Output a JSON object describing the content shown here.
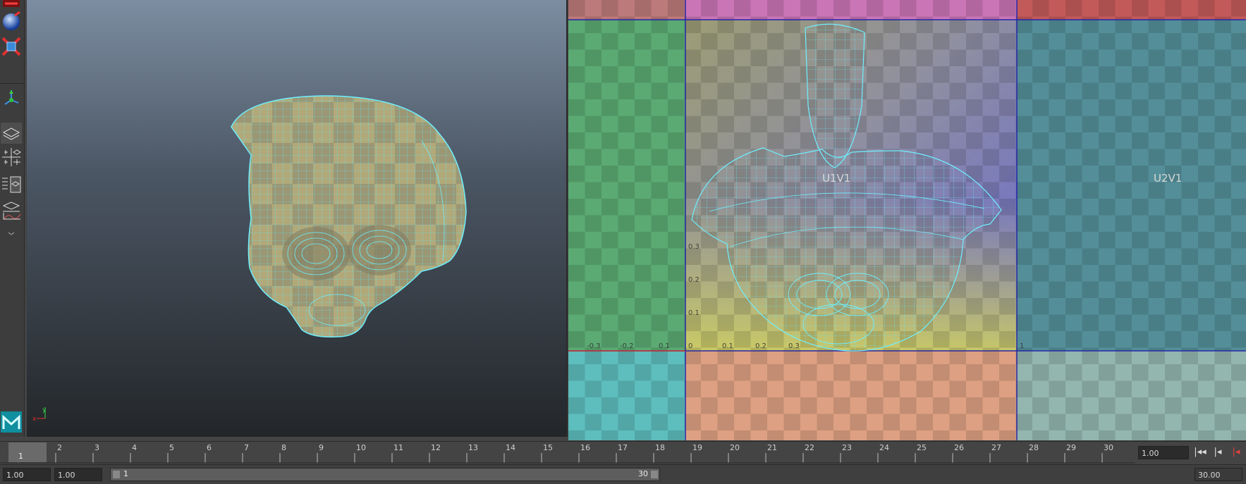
{
  "timeline": {
    "ticks": [
      "1",
      "2",
      "3",
      "4",
      "5",
      "6",
      "7",
      "8",
      "9",
      "10",
      "11",
      "12",
      "13",
      "14",
      "15",
      "16",
      "17",
      "18",
      "19",
      "20",
      "21",
      "22",
      "23",
      "24",
      "25",
      "26",
      "27",
      "28",
      "29",
      "30"
    ],
    "current_frame": "1",
    "current_time_field": "1.00"
  },
  "range": {
    "start_time": "1.00",
    "playback_start": "1.00",
    "slider_start": "1",
    "slider_end": "30",
    "end_time": "30.00"
  },
  "uv_editor": {
    "tile_labels": [
      "U1V1",
      "U2V1"
    ],
    "axis_labels_u": [
      "-0.3",
      "-0.2",
      "0.1",
      "0",
      "0.1",
      "0.2",
      "0.3"
    ],
    "axis_labels_v": [
      "0.1",
      "0.2",
      "0.3"
    ],
    "corner_label": "1"
  },
  "viewport": {
    "axis_y": "y",
    "axis_x": "x"
  },
  "icons": {
    "move": "move-tool-icon",
    "sphere": "sphere-icon",
    "scale": "scale-tool-icon",
    "manip": "manipulator-icon",
    "layout1": "single-pane-layout-icon",
    "layout2": "four-pane-layout-icon",
    "layout3": "outliner-layout-icon",
    "layout4": "graph-layout-icon",
    "more": "more-icon",
    "logo": "maya-logo-icon",
    "playback": [
      "step-back-icon",
      "go-to-start-icon",
      "play-back-icon"
    ]
  }
}
